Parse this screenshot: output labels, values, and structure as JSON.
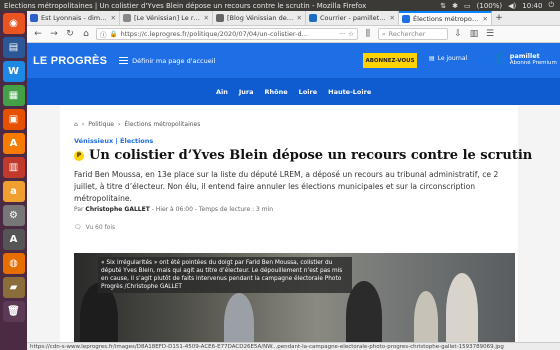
{
  "system": {
    "window_title": "Elections métropolitaines | Un colistier d'Yves Blein dépose un recours contre le scrutin - Mozilla Firefox",
    "battery": "(100%)",
    "time": "10:40"
  },
  "tabs": [
    {
      "label": "Est Lyonnais - dimanche",
      "color": "#2a60c7"
    },
    {
      "label": "[Le Vénissian] Le recou",
      "color": "#888888"
    },
    {
      "label": "[Blog Vénissian de Pierr",
      "color": "#666666"
    },
    {
      "label": "Courrier - pamillet@ven",
      "color": "#1b6ec2"
    },
    {
      "label": "Élections métropolitaine",
      "color": "#1e6ee6"
    }
  ],
  "nav": {
    "url": "https://c.leprogres.fr/politique/2020/07/04/un-colistier-d…",
    "search_placeholder": "Rechercher"
  },
  "site": {
    "logo": "LE PROGRÈS",
    "regions_label": "Définir ma page d'accueil",
    "subscribe": "ABONNEZ-VOUS",
    "journal": "Le journal",
    "user_name": "pamillet",
    "user_status": "Abonné Premium",
    "regions": [
      "Ain",
      "Jura",
      "Rhône",
      "Loire",
      "Haute-Loire"
    ]
  },
  "article": {
    "breadcrumb": [
      "Politique",
      "Élections métropolitaines"
    ],
    "kicker": "Vénissieux | Élections",
    "premium_badge": "P",
    "headline": "Un colistier d’Yves Blein dépose un recours contre le scrutin",
    "chapo": "Farid Ben Moussa, en 13e place sur la liste du député LREM, a déposé un recours au tribunal administratif, ce 2 juillet, à titre d’électeur. Non élu, il entend faire annuler les élections municipales et sur la circonscription métropolitaine.",
    "byline_prefix": "Par",
    "author": "Christophe GALLET",
    "byline_rest": "- Hier à 06:00 - Temps de lecture : 3 min",
    "comments": "Vu 60 fois",
    "photo_caption": "« Six irrégularités » ont été pointées du doigt par Farid Ben Moussa, colistier du député Yves Blein, mais qui agit au titre d’électeur. Le dépouillement n’est pas mis en cause, il s’agit plutôt de faits intervenus pendant la campagne électorale  Photo Progrès /Christophe GALLET"
  },
  "status_bar": "https://cdn-s-www.leprogres.fr/images/D8A18EFD-D151-4509-ACE6-E77DACD26E5A/NW...pendant-la-campagne-electorale-photo-progres-christophe-gallet-1593789069.jpg"
}
